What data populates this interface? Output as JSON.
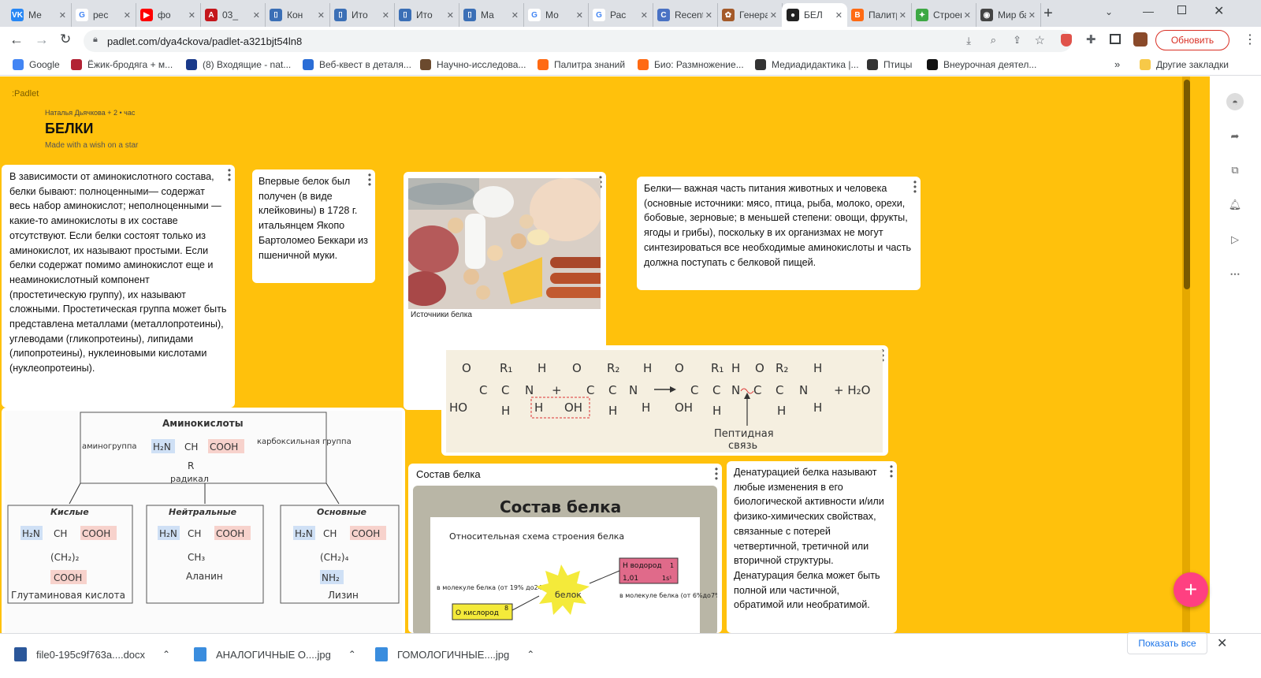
{
  "tabs": [
    {
      "label": "Ме",
      "fav_color": "#2787f5",
      "fav_text": "VK"
    },
    {
      "label": "рес",
      "fav_color": "#ffffff",
      "fav_text": "G"
    },
    {
      "label": "фо",
      "fav_color": "#ff0000",
      "fav_text": "▶"
    },
    {
      "label": "03_",
      "fav_color": "#c4161c",
      "fav_text": "A"
    },
    {
      "label": "Кон",
      "fav_color": "#3b6fb6",
      "fav_text": "⌷"
    },
    {
      "label": "Ито",
      "fav_color": "#3b6fb6",
      "fav_text": "⌷"
    },
    {
      "label": "Ито",
      "fav_color": "#3b6fb6",
      "fav_text": "⌷"
    },
    {
      "label": "Ма",
      "fav_color": "#3b6fb6",
      "fav_text": "⌷"
    },
    {
      "label": "Мо",
      "fav_color": "#ffffff",
      "fav_text": "G"
    },
    {
      "label": "Рас",
      "fav_color": "#ffffff",
      "fav_text": "G"
    },
    {
      "label": "Recents",
      "fav_color": "#4a72c4",
      "fav_text": "C"
    },
    {
      "label": "Генерат",
      "fav_color": "#a45a2a",
      "fav_text": "✿"
    },
    {
      "label": "БЕЛ",
      "fav_color": "#222222",
      "fav_text": "●"
    },
    {
      "label": "Палитр",
      "fav_color": "#ff6a13",
      "fav_text": "B"
    },
    {
      "label": "Строен",
      "fav_color": "#3da844",
      "fav_text": "✦"
    },
    {
      "label": "Мир ба",
      "fav_color": "#444444",
      "fav_text": "◉"
    }
  ],
  "browser": {
    "url": "padlet.com/dya4ckova/padlet-a321bjt54ln8",
    "update_label": "Обновить",
    "new_tab": "+"
  },
  "bookmarks": [
    {
      "label": "Google",
      "color": "#4285f4"
    },
    {
      "label": "Ёжик-бродяга + м...",
      "color": "#b22234"
    },
    {
      "label": "(8) Входящие - nat...",
      "color": "#1a3a8a"
    },
    {
      "label": "Веб-квест в деталя...",
      "color": "#2a6dd6"
    },
    {
      "label": "Научно-исследова...",
      "color": "#6b4a2e"
    },
    {
      "label": "Палитра знаний",
      "color": "#ff6a13"
    },
    {
      "label": "Био: Размножение...",
      "color": "#ff6a13"
    },
    {
      "label": "Медиадидактика |...",
      "color": "#333333"
    },
    {
      "label": "Птицы",
      "color": "#333333"
    },
    {
      "label": "Внеурочная деятел...",
      "color": "#111111"
    }
  ],
  "other_bookmarks": "Другие закладки",
  "padlet": {
    "logo": ":Padlet",
    "author_line": "Наталья Дьячкова  + 2  • час",
    "title": "БЕЛКИ",
    "subtitle": "Made with a wish on a star",
    "bg": "#ffc10c"
  },
  "cards": {
    "amino_types": "В зависимости от аминокислотного состава, белки бывают: полноценными— содержат весь набор аминокислот; неполноценными — какие-то аминокислоты в их составе отсутствуют. Если белки состоят только из аминокислот, их называют простыми. Если белки содержат помимо аминокислот еще и неаминокислотный компонент (простетическую группу), их называют сложными. Простетическая группа может быть представлена металлами (металлопротеины), углеводами (гликопротеины), липидами (липопротеины), нуклеиновыми кислотами (нуклеопротеины).",
    "first_protein": "Впервые белок был получен (в виде клейковины) в 1728 г. итальянцем Якопо Бартоломео Беккари из пшеничной муки.",
    "sources_caption": "Источники белка",
    "nutrition": "Белки— важная часть питания животных и человека (основные источники: мясо, птица, рыба, молоко, орехи, бобовые, зерновые; в меньшей степени: овощи, фрукты, ягоды и грибы), поскольку в их организмах не могут синтезироваться все необходимые аминокислоты и часть должна поступать с белковой пищей.",
    "composition_title": "Состав белка",
    "denaturation": "Денатурацией белка называют любые изменения в его биологической активности и/или физико-химических свойствах, связанные с потерей четвертичной, третичной или вторичной структуры. Денатурация белка может быть полной или частичной, обратимой или необратимой."
  },
  "amino_diagram": {
    "title": "Аминокислоты",
    "amino_group": "аминогруппа",
    "carboxyl_group": "карбоксильная группа",
    "formula_left": "H₂N",
    "formula_mid": "CH",
    "formula_right": "COOH",
    "radical_letter": "R",
    "radical": "радикал",
    "acidic": "Кислые",
    "neutral": "Нейтральные",
    "basic": "Основные",
    "acidic_chain": "(CH₂)₂",
    "acidic_tail": "COOH",
    "neutral_chain": "CH₃",
    "basic_chain": "(CH₂)₄",
    "basic_tail": "NH₂",
    "glutamic": "Глутаминовая кислота",
    "alanine": "Аланин",
    "lysine": "Лизин"
  },
  "peptide_diagram": {
    "label_line1": "Пептидная",
    "label_line2": "связь",
    "water": "+ H₂O",
    "plus": "+",
    "o": "O",
    "ho": "HO",
    "oh": "OH",
    "c": "C",
    "n": "N",
    "h": "H",
    "r1": "R₁",
    "r2": "R₂"
  },
  "composition_diagram": {
    "heading": "Состав белка",
    "subheading": "Относительная схема строения белка",
    "center": "белок",
    "left_note": "в молекуле белка (от 19% до24%)",
    "right_note": "в молекуле белка (от 6%до7%)",
    "hydrogen": "H водород",
    "hydrogen_mass": "1,01",
    "hydrogen_num": "1",
    "hydrogen_shell": "1s¹",
    "oxygen": "O кислород",
    "oxygen_num": "8"
  },
  "downloads": [
    {
      "label": "file0-195c9f763a....docx",
      "color": "#2b579a"
    },
    {
      "label": "АНАЛОГИЧНЫЕ О....jpg",
      "color": "#3a8dde"
    },
    {
      "label": "ГОМОЛОГИЧНЫЕ....jpg",
      "color": "#3a8dde"
    }
  ],
  "show_all": "Показать все",
  "colors": {
    "accent": "#ff4081",
    "update_border": "#d93025"
  }
}
